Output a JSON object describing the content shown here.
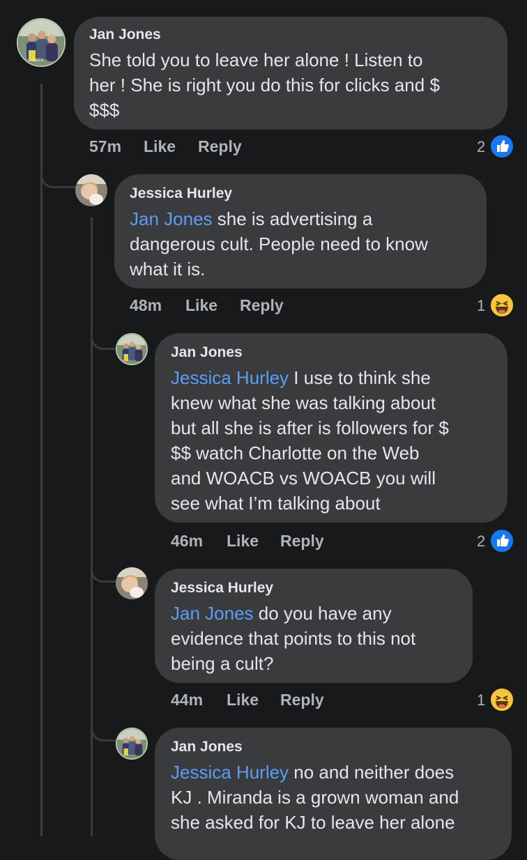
{
  "comments": [
    {
      "author": "Jan Jones",
      "line1": "She told you to leave her alone ! Listen to",
      "line2": "her ! She is right you do this for clicks and $",
      "line3": "$$$",
      "time": "57m",
      "like": "Like",
      "reply": "Reply",
      "reaction_count": "2",
      "reaction_icon": "like-icon"
    },
    {
      "author": "Jessica Hurley",
      "mention": "Jan Jones",
      "line1": " she is advertising a",
      "line2": "dangerous cult. People need to know",
      "line3": "what it is.",
      "time": "48m",
      "like": "Like",
      "reply": "Reply",
      "reaction_count": "1",
      "reaction_icon": "haha-icon"
    },
    {
      "author": "Jan Jones",
      "mention": "Jessica Hurley",
      "line1": " I use to think she",
      "line2": "knew what she was talking about",
      "line3": "but all she is after is followers for $",
      "line4": "$$ watch Charlotte on the Web",
      "line5": "and WOACB vs WOACB you will",
      "line6": "see what I’m talking about",
      "time": "46m",
      "like": "Like",
      "reply": "Reply",
      "reaction_count": "2",
      "reaction_icon": "like-icon"
    },
    {
      "author": "Jessica Hurley",
      "mention": "Jan Jones",
      "line1": " do you have any",
      "line2": "evidence that points to this not",
      "line3": "being a cult?",
      "time": "44m",
      "like": "Like",
      "reply": "Reply",
      "reaction_count": "1",
      "reaction_icon": "haha-icon"
    },
    {
      "author": "Jan Jones",
      "mention": "Jessica Hurley",
      "line1": " no and neither does",
      "line2": "KJ . Miranda is a grown woman and",
      "line3": "she asked for KJ to leave her alone"
    }
  ],
  "colors": {
    "background": "#18191a",
    "bubble": "#3a3b3c",
    "mention": "#5a9ef8",
    "meta": "#b0b3b8",
    "like_blue": "#1877f2",
    "haha_yellow": "#f7c53b"
  }
}
